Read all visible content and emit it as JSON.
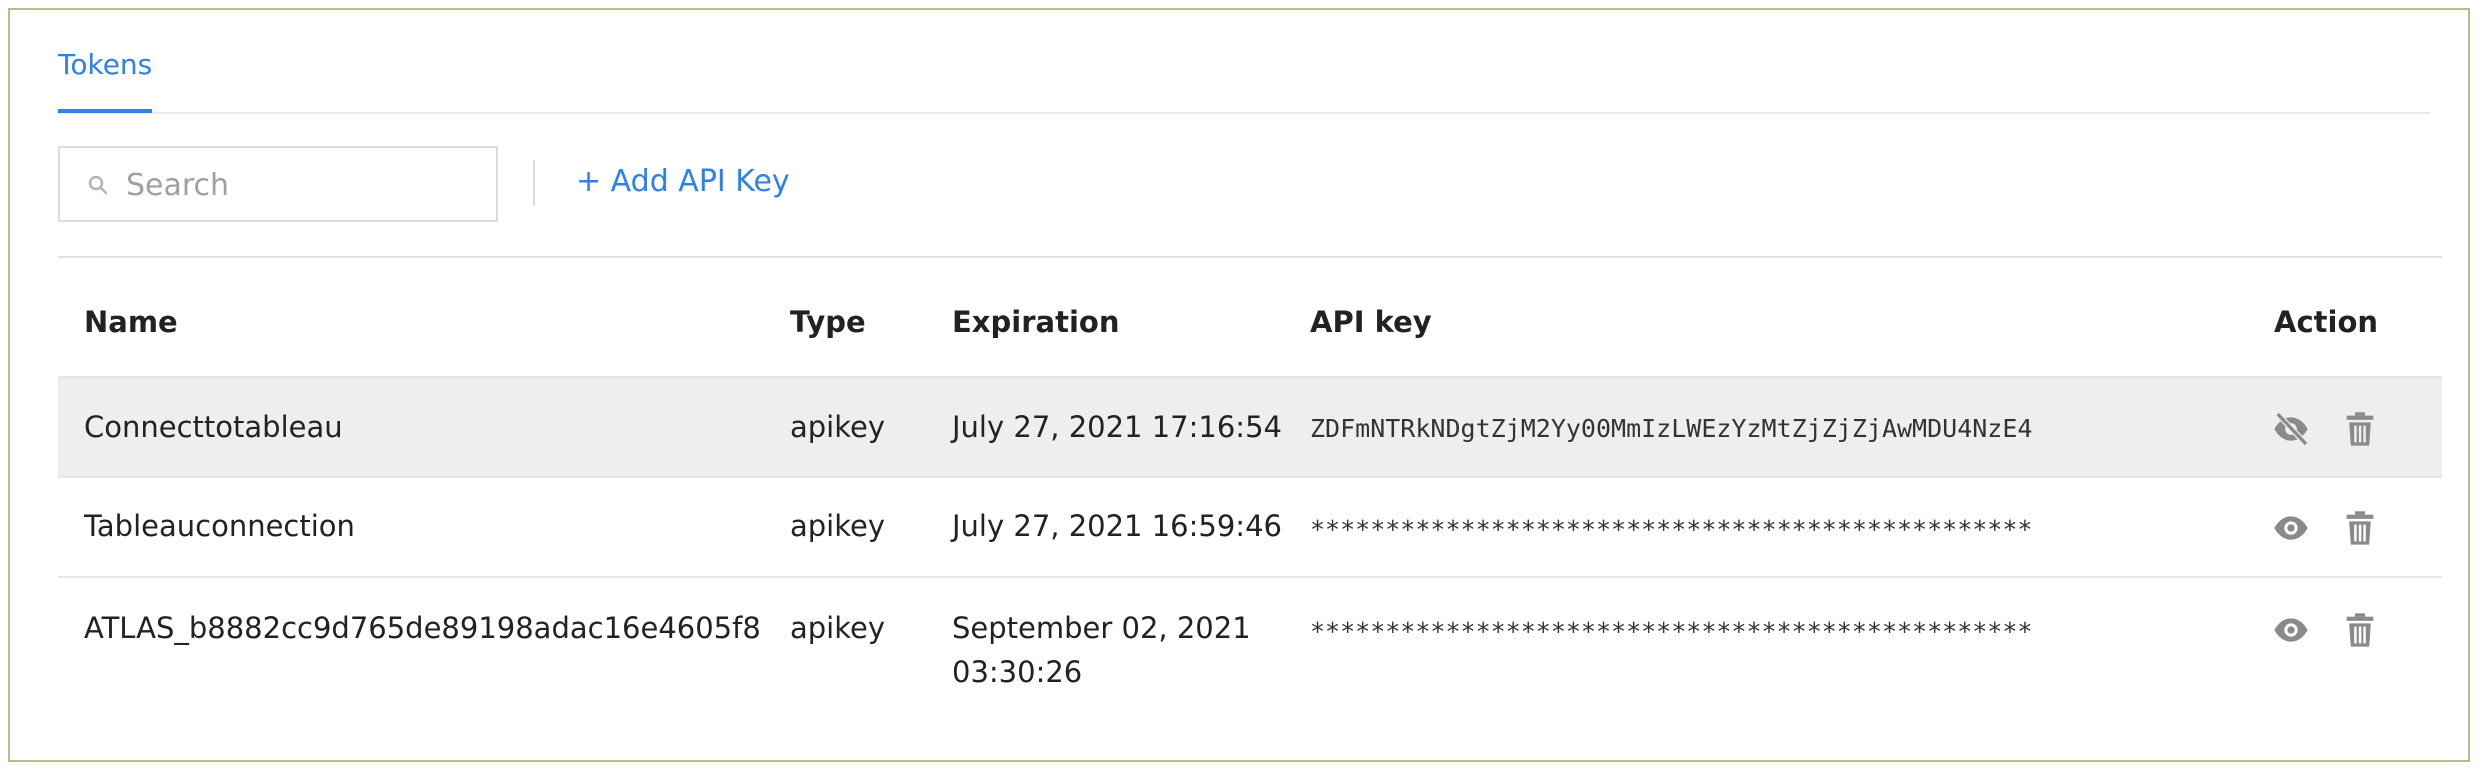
{
  "tabs": [
    {
      "label": "Tokens"
    }
  ],
  "toolbar": {
    "search_placeholder": "Search",
    "add_label": "+ Add API Key"
  },
  "table": {
    "columns": [
      "Name",
      "Type",
      "Expiration",
      "API key",
      "Action"
    ],
    "rows": [
      {
        "name": "Connecttotableau",
        "type": "apikey",
        "expiration_line1": "July 27, 2021 17:16:54",
        "expiration_line2": "",
        "api_key": "ZDFmNTRkNDgtZjM2Yy00MmIzLWEzYzMtZjZjZjAwMDU4NzE4",
        "key_visible": true
      },
      {
        "name": "Tableauconnection",
        "type": "apikey",
        "expiration_line1": "July 27, 2021 16:59:46",
        "expiration_line2": "",
        "api_key": "************************************************",
        "key_visible": false
      },
      {
        "name": "ATLAS_b8882cc9d765de89198adac16e4605f8",
        "type": "apikey",
        "expiration_line1": "September 02, 2021",
        "expiration_line2": "03:30:26",
        "api_key": "************************************************",
        "key_visible": false
      }
    ]
  },
  "icons": {
    "search": "search-icon",
    "hide": "eye-off-icon",
    "show": "eye-icon",
    "delete": "trash-icon"
  },
  "colors": {
    "accent": "#2f80ed",
    "icon": "#8a8a8a",
    "selected_row": "#efeeee",
    "frame_border": "#b9bb8c"
  }
}
